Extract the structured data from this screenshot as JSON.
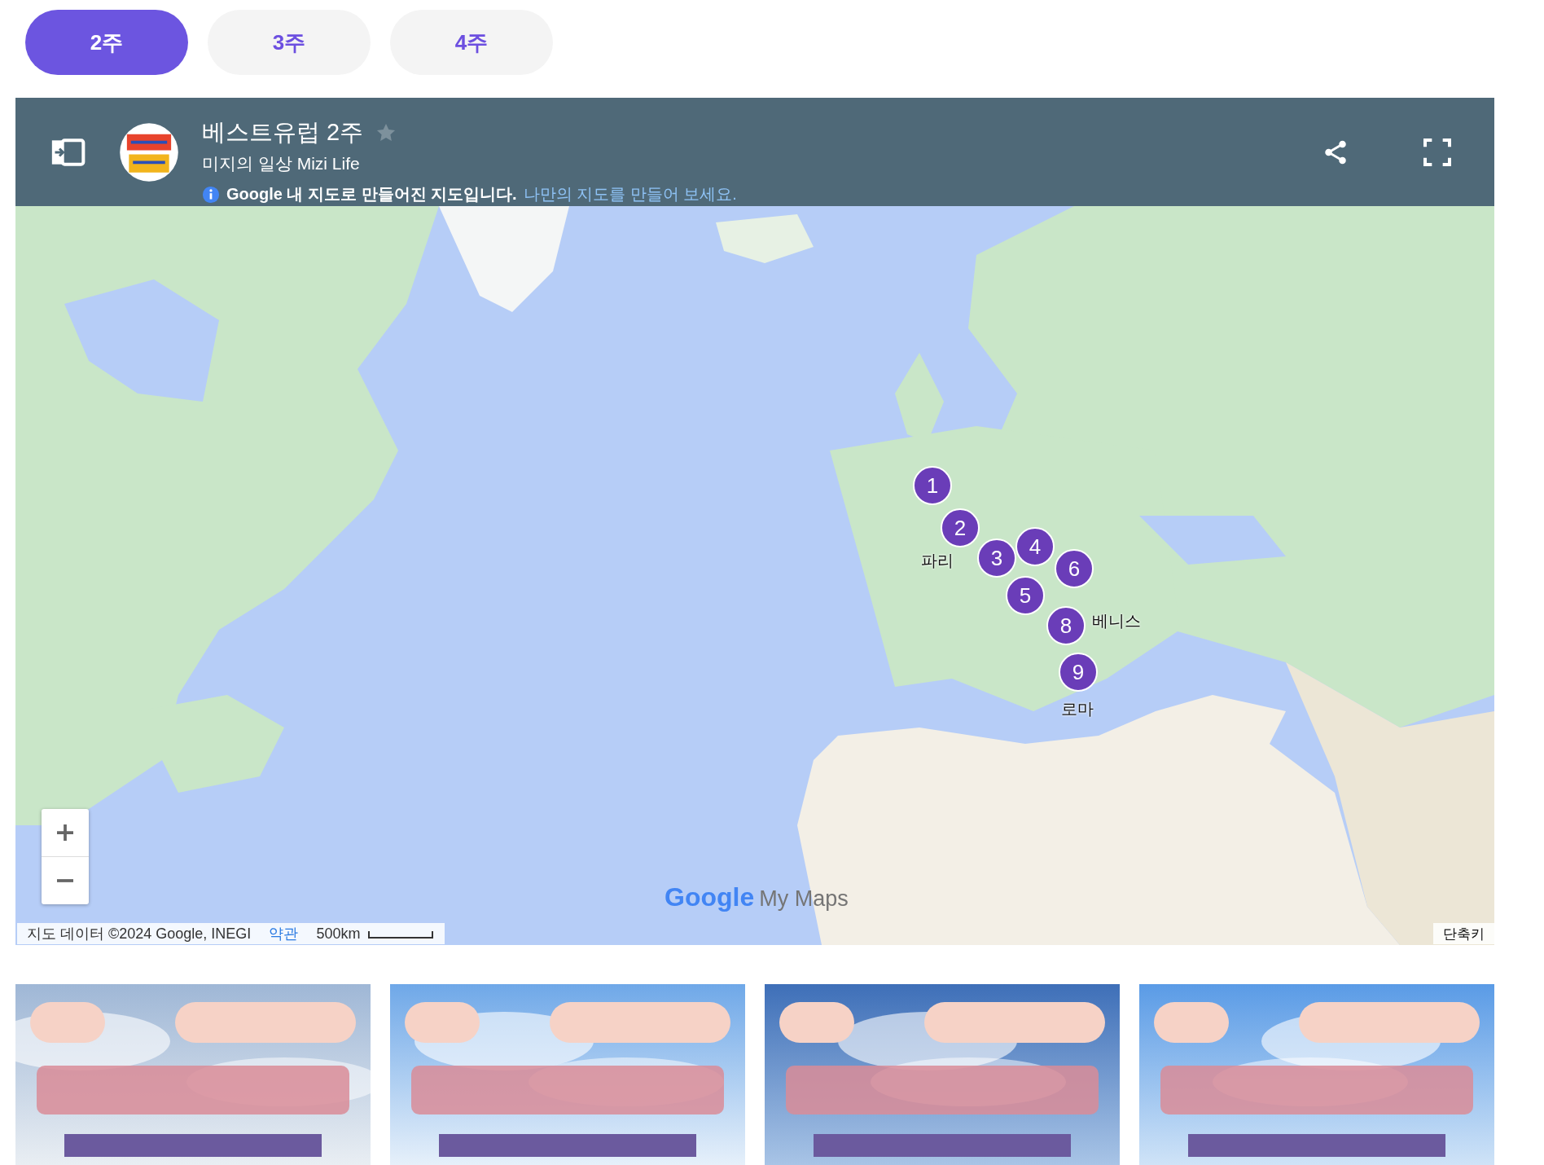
{
  "tabs": [
    {
      "label": "2주",
      "selected": true
    },
    {
      "label": "3주",
      "selected": false
    },
    {
      "label": "4주",
      "selected": false
    }
  ],
  "map_header": {
    "title": "베스트유럽 2주",
    "starred": false,
    "subtitle": "미지의 일상 Mizi Life",
    "notice": "Google 내 지도로 만들어진 지도입니다.",
    "notice_link": "나만의 지도를 만들어 보세요."
  },
  "map": {
    "kind": "picture",
    "markers": [
      {
        "label": "1"
      },
      {
        "label": "2",
        "place": "파리"
      },
      {
        "label": "3"
      },
      {
        "label": "4"
      },
      {
        "label": "5"
      },
      {
        "label": "6"
      },
      {
        "label": "8",
        "place": "베니스"
      },
      {
        "label": "9",
        "place": "로마"
      }
    ],
    "branding": {
      "google": "Google",
      "product": "My Maps"
    },
    "attribution": "지도 데이터 ©2024 Google, INEGI",
    "terms": "약관",
    "scale": "500km",
    "shortcuts": "단축키"
  }
}
